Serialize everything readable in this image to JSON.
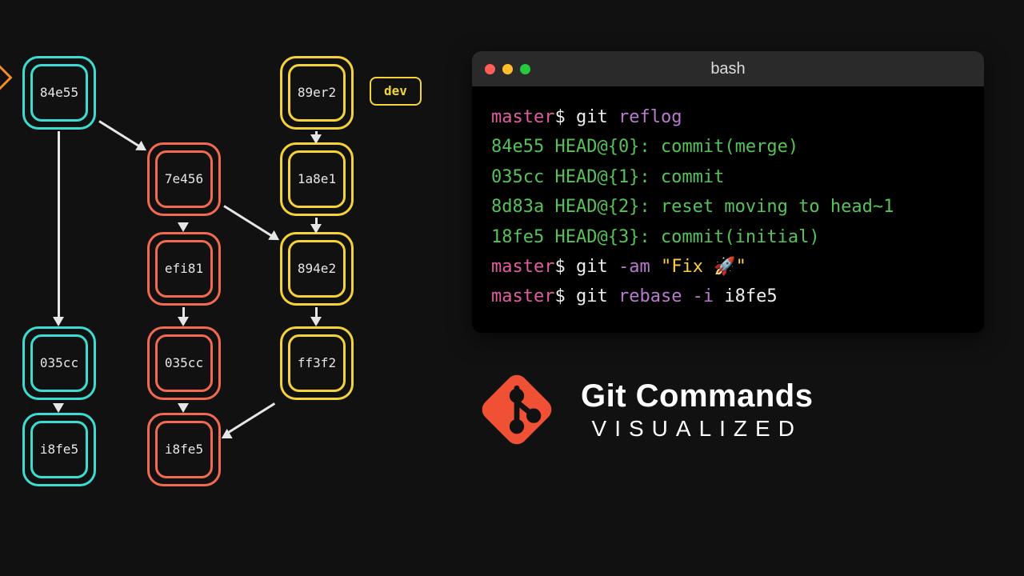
{
  "branchTag": "dev",
  "commits": {
    "cyan": [
      "84e55",
      "035cc",
      "i8fe5"
    ],
    "coral": [
      "7e456",
      "efi81",
      "035cc",
      "i8fe5"
    ],
    "yellow": [
      "89er2",
      "1a8e1",
      "894e2",
      "ff3f2"
    ]
  },
  "terminal": {
    "title": "bash",
    "lines": [
      {
        "parts": [
          {
            "t": "master",
            "c": "pink"
          },
          {
            "t": "$ ",
            "c": "white"
          },
          {
            "t": "git ",
            "c": "white"
          },
          {
            "t": "reflog",
            "c": "purple"
          }
        ]
      },
      {
        "parts": [
          {
            "t": "84e55 HEAD@{0}: commit(merge)",
            "c": "green"
          }
        ]
      },
      {
        "parts": [
          {
            "t": "035cc HEAD@{1}: commit",
            "c": "green"
          }
        ]
      },
      {
        "parts": [
          {
            "t": "8d83a HEAD@{2}: reset moving to head~1",
            "c": "green"
          }
        ]
      },
      {
        "parts": [
          {
            "t": "18fe5 HEAD@{3}: commit(initial)",
            "c": "green"
          }
        ]
      },
      {
        "parts": [
          {
            "t": "master",
            "c": "pink"
          },
          {
            "t": "$ ",
            "c": "white"
          },
          {
            "t": "git ",
            "c": "white"
          },
          {
            "t": "-am ",
            "c": "purple"
          },
          {
            "t": "\"Fix ",
            "c": "yellow"
          },
          {
            "t": "🚀",
            "c": "white"
          },
          {
            "t": "\"",
            "c": "yellow"
          }
        ]
      },
      {
        "parts": [
          {
            "t": "master",
            "c": "pink"
          },
          {
            "t": "$ ",
            "c": "white"
          },
          {
            "t": "git ",
            "c": "white"
          },
          {
            "t": "rebase -i ",
            "c": "purple"
          },
          {
            "t": "i8fe5",
            "c": "white"
          }
        ]
      }
    ]
  },
  "brand": {
    "title": "Git Commands",
    "subtitle": "VISUALIZED"
  },
  "colors": {
    "cyan": "#3ddcd0",
    "coral": "#f26b50",
    "yellow": "#f4d23a",
    "gitOrange": "#f05033"
  }
}
